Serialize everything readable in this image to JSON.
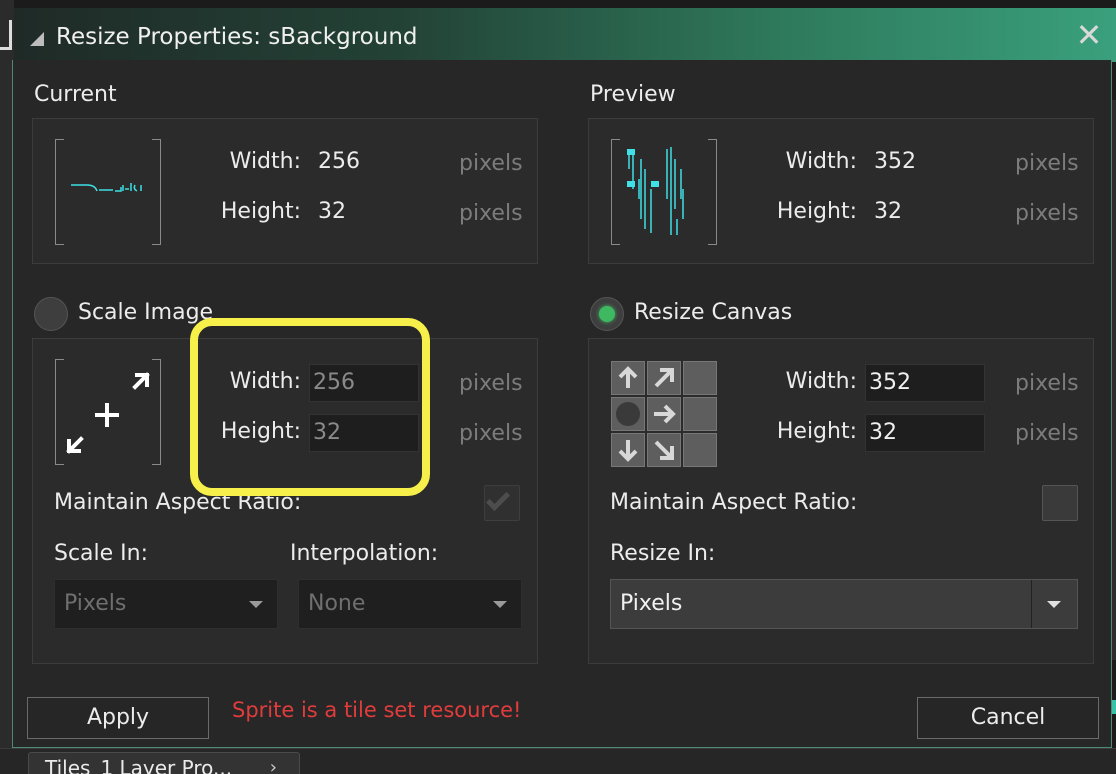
{
  "window": {
    "title": "Resize Properties: sBackground",
    "close_glyph": "✕"
  },
  "background": {
    "bottom_tab_label": "Tiles_1 Layer Pro...",
    "bottom_tab_chevron": "›"
  },
  "current": {
    "heading": "Current",
    "width_label": "Width:",
    "width_value": "256",
    "height_label": "Height:",
    "height_value": "32",
    "unit": "pixels"
  },
  "preview": {
    "heading": "Preview",
    "width_label": "Width:",
    "width_value": "352",
    "height_label": "Height:",
    "height_value": "32",
    "unit": "pixels"
  },
  "scale_image": {
    "radio_label": "Scale Image",
    "selected": false,
    "width_label": "Width:",
    "width_value": "256",
    "height_label": "Height:",
    "height_value": "32",
    "unit": "pixels",
    "maintain_aspect_label": "Maintain Aspect Ratio:",
    "maintain_aspect_checked": true,
    "scale_in_label": "Scale In:",
    "scale_in_value": "Pixels",
    "interpolation_label": "Interpolation:",
    "interpolation_value": "None"
  },
  "resize_canvas": {
    "radio_label": "Resize Canvas",
    "selected": true,
    "width_label": "Width:",
    "width_value": "352",
    "height_label": "Height:",
    "height_value": "32",
    "unit": "pixels",
    "maintain_aspect_label": "Maintain Aspect Ratio:",
    "maintain_aspect_checked": false,
    "resize_in_label": "Resize In:",
    "resize_in_value": "Pixels",
    "anchor_selected": "middle-left"
  },
  "footer": {
    "apply_label": "Apply",
    "cancel_label": "Cancel",
    "error_message": "Sprite is a tile set resource!"
  },
  "colors": {
    "accent_green": "#3fb862",
    "highlight_yellow": "#f7f04a",
    "error_red": "#e13c3c",
    "sprite_cyan": "#3ee0e6"
  }
}
